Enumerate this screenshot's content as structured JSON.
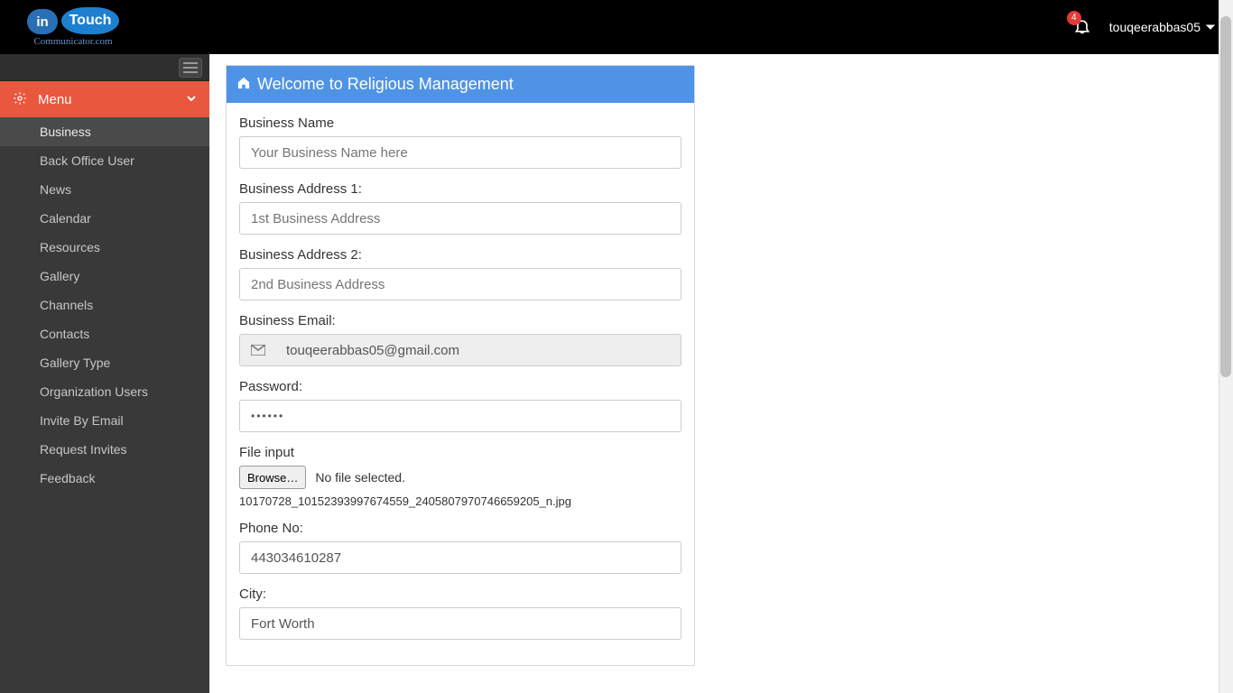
{
  "header": {
    "logo_in": "in",
    "logo_touch": "Touch",
    "logo_sub": "Communicator.com",
    "notification_count": "4",
    "username": "touqeerabbas05"
  },
  "sidebar": {
    "menu_label": "Menu",
    "items": [
      {
        "label": "Business",
        "active": true
      },
      {
        "label": "Back Office User"
      },
      {
        "label": "News"
      },
      {
        "label": "Calendar"
      },
      {
        "label": "Resources"
      },
      {
        "label": "Gallery"
      },
      {
        "label": "Channels"
      },
      {
        "label": "Contacts"
      },
      {
        "label": "Gallery Type"
      },
      {
        "label": "Organization Users"
      },
      {
        "label": "Invite By Email"
      },
      {
        "label": "Request Invites"
      },
      {
        "label": "Feedback"
      }
    ]
  },
  "panel": {
    "title": "Welcome to Religious Management"
  },
  "form": {
    "business_name": {
      "label": "Business Name",
      "placeholder": "Your Business Name here",
      "value": ""
    },
    "address1": {
      "label": "Business Address 1:",
      "placeholder": "1st Business Address",
      "value": ""
    },
    "address2": {
      "label": "Business Address 2:",
      "placeholder": "2nd Business Address",
      "value": ""
    },
    "email": {
      "label": "Business Email:",
      "value": "touqeerabbas05@gmail.com"
    },
    "password": {
      "label": "Password:",
      "value": "••••••"
    },
    "file": {
      "label": "File input",
      "button": "Browse…",
      "status": "No file selected.",
      "name": "10170728_10152393997674559_2405807970746659205_n.jpg"
    },
    "phone": {
      "label": "Phone No:",
      "value": "443034610287"
    },
    "city": {
      "label": "City:",
      "value": "Fort Worth"
    }
  }
}
